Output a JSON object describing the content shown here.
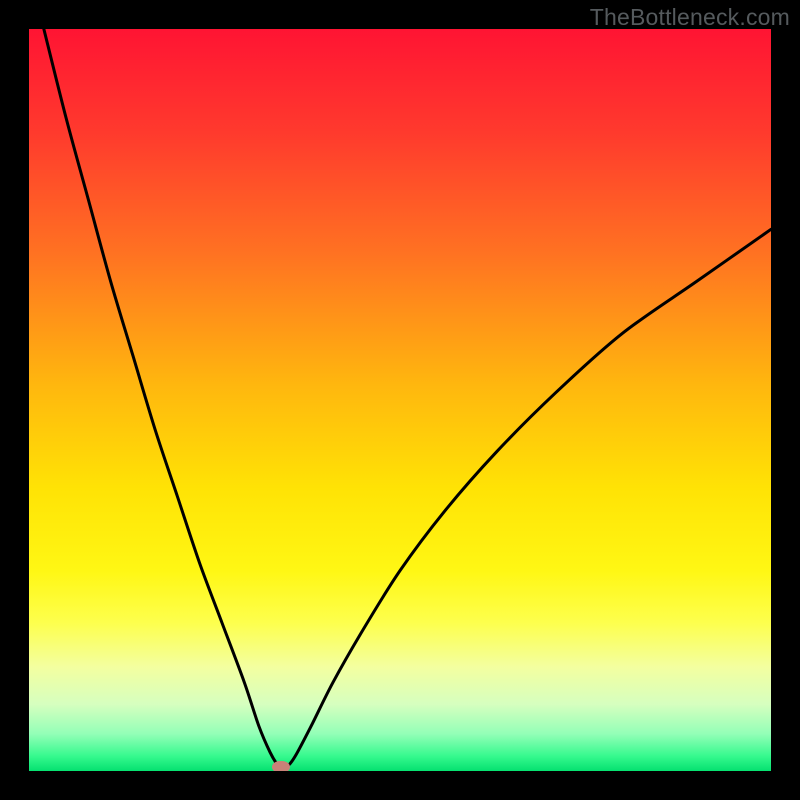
{
  "watermark": "TheBottleneck.com",
  "colors": {
    "frame": "#000000",
    "curve": "#000000",
    "marker": "#c98178",
    "gradient_stops": [
      {
        "pct": 0,
        "color": "#ff1433"
      },
      {
        "pct": 14,
        "color": "#ff3a2d"
      },
      {
        "pct": 30,
        "color": "#ff7122"
      },
      {
        "pct": 48,
        "color": "#ffb70e"
      },
      {
        "pct": 62,
        "color": "#ffe305"
      },
      {
        "pct": 73,
        "color": "#fff714"
      },
      {
        "pct": 80,
        "color": "#fdff4d"
      },
      {
        "pct": 86,
        "color": "#f3ffa0"
      },
      {
        "pct": 91,
        "color": "#d6ffbf"
      },
      {
        "pct": 95,
        "color": "#93ffb7"
      },
      {
        "pct": 98,
        "color": "#36f98e"
      },
      {
        "pct": 100,
        "color": "#05e170"
      }
    ]
  },
  "chart_data": {
    "type": "line",
    "title": "",
    "xlabel": "",
    "ylabel": "",
    "xlim": [
      0,
      100
    ],
    "ylim": [
      0,
      100
    ],
    "grid": false,
    "legend": false,
    "series": [
      {
        "name": "curve",
        "x": [
          2,
          5,
          8,
          11,
          14,
          17,
          20,
          23,
          26,
          29,
          31,
          32.5,
          33.5,
          34,
          35,
          36,
          38,
          41,
          45,
          50,
          56,
          63,
          71,
          80,
          90,
          100
        ],
        "values": [
          100,
          88,
          77,
          66,
          56,
          46,
          37,
          28,
          20,
          12,
          6,
          2.5,
          0.8,
          0.4,
          0.8,
          2.2,
          6,
          12,
          19,
          27,
          35,
          43,
          51,
          59,
          66,
          73
        ]
      }
    ],
    "marker": {
      "x": 34,
      "y": 0.6
    }
  }
}
